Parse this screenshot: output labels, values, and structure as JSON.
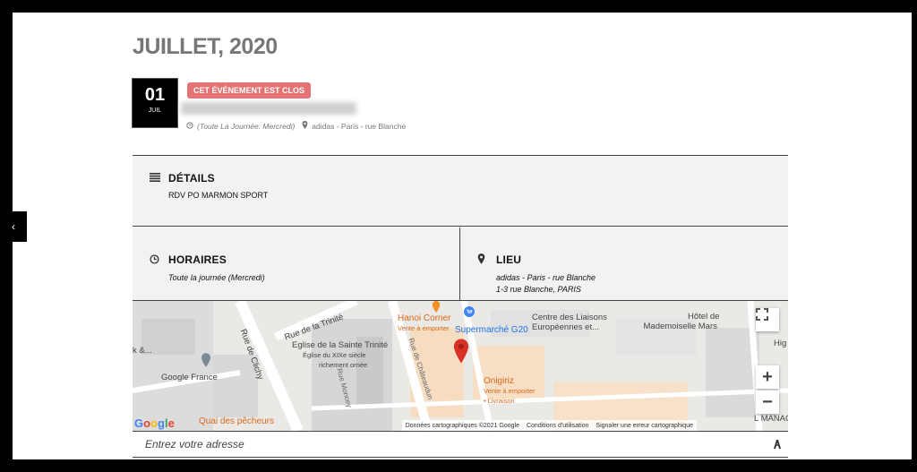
{
  "sidebar_toggle": {
    "icon": "chevron-left-icon",
    "label": "‹"
  },
  "header": {
    "month_title": "JUILLET, 2020"
  },
  "event": {
    "date_day": "01",
    "date_month": "JUIL",
    "status_badge": "CET ÉVÉNEMENT EST CLOS",
    "meta_time": "(Toute La Journée: Mercredi)",
    "meta_location": "adidas - Paris - rue Blanche"
  },
  "details": {
    "heading": "DÉTAILS",
    "text": "RDV PO MARMON SPORT"
  },
  "horaires": {
    "heading": "HORAIRES",
    "text": "Toute la journée (Mercredi)"
  },
  "lieu": {
    "heading": "LIEU",
    "line1": "adidas - Paris - rue Blanche",
    "line2": "1-3 rue Blanche, PARIS"
  },
  "map": {
    "streets": [
      "Rue de Clichy",
      "Rue de la Trinité",
      "Rue Moncey",
      "Rue de Châteaudun"
    ],
    "labels": {
      "trinite": "Eglise de la Sainte Trinité",
      "trinite_sub1": "Église du XIXe siècle",
      "trinite_sub2": "richement ornée",
      "google_france": "Google France",
      "hanoi": "Hanoi Corner",
      "hanoi_sub": "Vente à emporter",
      "supermarche": "Supermarché G20",
      "centre": "Centre des Liaisons",
      "centre_2": "Européennes et...",
      "hotel": "Hôtel de",
      "hotel_2": "Mademoiselle Mars",
      "onigiriz": "Onigiriz",
      "onigiriz_sub1": "Vente à emporter",
      "onigiriz_sub2": "• Livraison",
      "quai": "Quai des pêcheurs",
      "managi": "L MANAGI",
      "higi": "Hig",
      "left_amp": "k &..."
    },
    "google_logo": "Google",
    "footer": {
      "data": "Données cartographiques ©2021 Google",
      "terms": "Conditions d'utilisation",
      "report": "Signaler une erreur cartographique"
    },
    "zoom_in": "+",
    "zoom_out": "−",
    "fullscreen": "⛶"
  },
  "address": {
    "placeholder": "Entrez votre adresse",
    "route_icon": "directions-icon"
  },
  "colors": {
    "badge": "#e57373",
    "panel_bg": "#f2f2f2",
    "title_gray": "#777777",
    "map_pin": "#d93025"
  }
}
